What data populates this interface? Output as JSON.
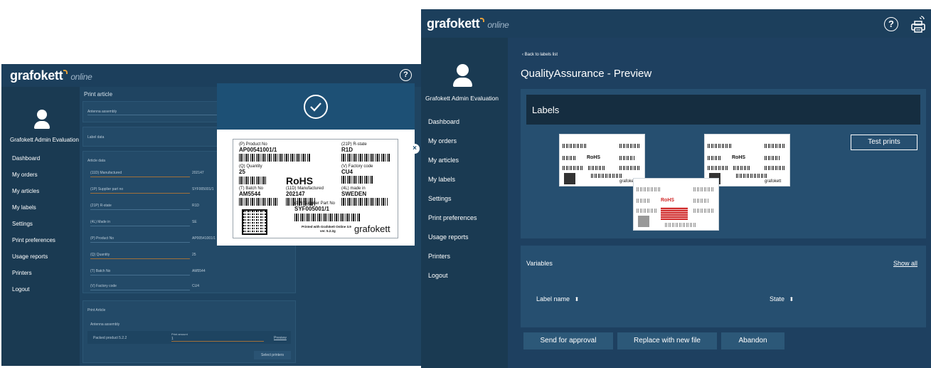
{
  "left_window": {
    "logo": "grafokett",
    "logo_suffix": "online",
    "help_icon": "?",
    "user_name": "Grafokett Admin Evaluation",
    "nav": [
      "Dashboard",
      "My orders",
      "My articles",
      "My labels",
      "Settings",
      "Print preferences",
      "Usage reports",
      "Printers",
      "Logout"
    ],
    "page_title": "Print article",
    "article_name": "Antenna assembly",
    "label_data_title": "Label data",
    "article_data_title": "Article data",
    "fields": [
      {
        "label": "(11D) Manufactured",
        "value": "202147"
      },
      {
        "label": "(1P) Supplier part no",
        "value": "SYF005001/1"
      },
      {
        "label": "(21P) R-state",
        "value": "R1D"
      },
      {
        "label": "(4L) Made in",
        "value": "SE"
      },
      {
        "label": "(P) Product No",
        "value": "AP00541001/1"
      },
      {
        "label": "(Q) Quantity",
        "value": "25"
      },
      {
        "label": "(T) Batch No",
        "value": "AM5544"
      },
      {
        "label": "(V) Factory code",
        "value": "CU4"
      }
    ],
    "print_article_title": "Print Article",
    "print_article_name": "Antenna assembly",
    "print_amount_label": "Print amount",
    "print_amount_value": "1",
    "packed_product": "Packed product 5.2.2",
    "preview_link": "Preview",
    "select_printers": "Select printers"
  },
  "modal": {
    "close": "×",
    "label": {
      "product_no_title": "(P) Product No",
      "product_no": "AP00541001/1",
      "rstate_title": "(21P) R-state",
      "rstate": "R1D",
      "quantity_title": "(Q) Quantity",
      "quantity": "25",
      "factory_title": "(V) Factory code",
      "factory": "CU4",
      "rohs": "RoHS",
      "batch_title": "(T) Batch No",
      "batch": "AM5544",
      "manufactured_title": "(11D) Manufactured",
      "manufactured": "202147",
      "madein_title": "(4L) made in",
      "madein": "SWEDEN",
      "supplier_title": "(1P) Supplier Part No",
      "supplier": "SYF005001/1",
      "printed_with": "Printed with Grafokett Online 3.9",
      "version": "ver. 5.2.2g",
      "brand": "grafokett"
    }
  },
  "right_window": {
    "logo": "grafokett",
    "logo_suffix": "online",
    "help_icon": "?",
    "user_name": "Grafokett Admin Evaluation",
    "nav": [
      "Dashboard",
      "My orders",
      "My articles",
      "My labels",
      "Settings",
      "Print preferences",
      "Usage reports",
      "Printers",
      "Logout"
    ],
    "back_link": "‹ Back to labels list",
    "page_title": "QualityAssurance - Preview",
    "labels_title": "Labels",
    "test_prints": "Test prints",
    "thumb_rohs": "RoHS",
    "thumb_brand": "grafokett",
    "variables_title": "Variables",
    "show_all": "Show all",
    "col_label_name": "Label name",
    "col_state": "State",
    "sort_icon": "⬍",
    "actions": [
      "Send for approval",
      "Replace with new file",
      "Abandon"
    ]
  }
}
